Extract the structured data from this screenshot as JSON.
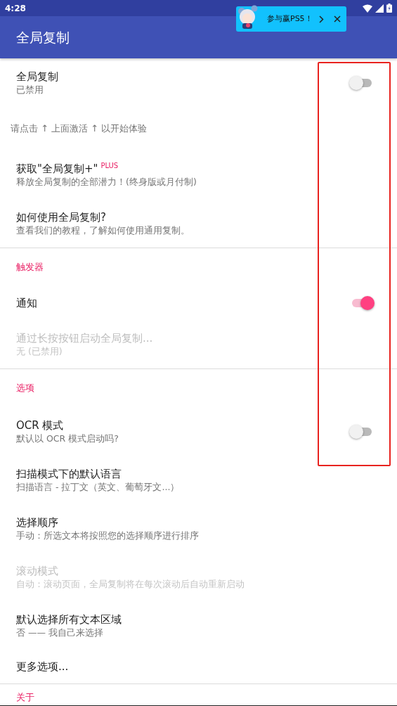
{
  "status_bar": {
    "time": "4:28"
  },
  "app_bar": {
    "title": "全局复制"
  },
  "promo_banner": {
    "text": "参与赢PS5！"
  },
  "sections": [
    {
      "items": [
        {
          "kind": "switch",
          "title": "全局复制",
          "subtitle": "已禁用",
          "on": false,
          "disabled": false
        },
        {
          "kind": "hint",
          "text": "请点击 ↑ 上面激活 ↑ 以开始体验"
        },
        {
          "kind": "text",
          "title": "获取\"全局复制+\"",
          "badge": "PLUS",
          "subtitle": "释放全局复制的全部潜力！(终身版或月付制)",
          "disabled": false
        },
        {
          "kind": "text",
          "title": "如何使用全局复制?",
          "subtitle": "查看我们的教程，了解如何使用通用复制。",
          "disabled": false
        }
      ]
    },
    {
      "header": "触发器",
      "items": [
        {
          "kind": "switch",
          "title": "通知",
          "on": true,
          "disabled": false
        },
        {
          "kind": "text",
          "title": "通过长按按钮启动全局复制...",
          "subtitle": "无 (已禁用)",
          "disabled": true
        }
      ]
    },
    {
      "header": "选项",
      "items": [
        {
          "kind": "switch",
          "title": "OCR 模式",
          "subtitle": "默认以 OCR 模式启动吗?",
          "on": false,
          "disabled": false
        },
        {
          "kind": "text",
          "title": "扫描模式下的默认语言",
          "subtitle": "扫描语言 - 拉丁文（英文、葡萄牙文...）",
          "disabled": false
        },
        {
          "kind": "text",
          "title": "选择顺序",
          "subtitle": "手动：所选文本将按照您的选择顺序进行排序",
          "disabled": false
        },
        {
          "kind": "text",
          "title": "滚动模式",
          "subtitle": "自动：滚动页面，全局复制将在每次滚动后自动重新启动",
          "disabled": true
        },
        {
          "kind": "text",
          "title": "默认选择所有文本区域",
          "subtitle": "否 —— 我自己来选择",
          "disabled": false
        },
        {
          "kind": "text",
          "title": "更多选项...",
          "disabled": false
        }
      ]
    },
    {
      "header": "关于"
    }
  ]
}
